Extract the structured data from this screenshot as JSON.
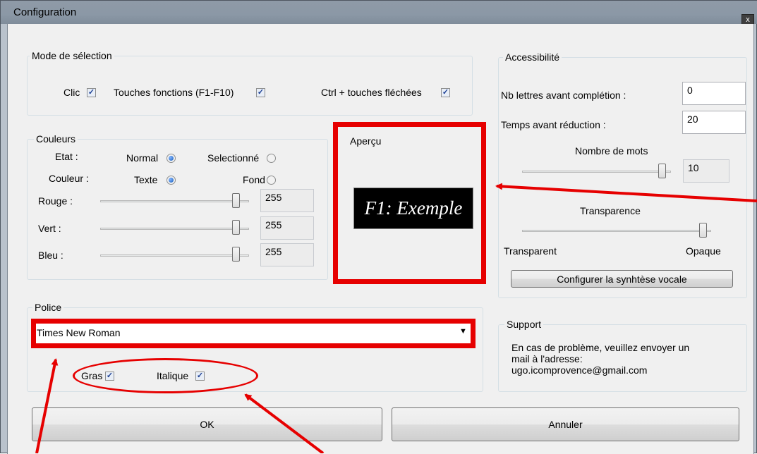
{
  "window": {
    "title": "Configuration",
    "close_glyph": "x"
  },
  "selection_mode": {
    "legend": "Mode de sélection",
    "click_label": "Clic",
    "fkeys_label": "Touches fonctions (F1-F10)",
    "ctrl_label": "Ctrl + touches fléchées"
  },
  "colors": {
    "legend": "Couleurs",
    "state_label": "Etat :",
    "normal_label": "Normal",
    "selected_label": "Selectionné",
    "color_label": "Couleur :",
    "text_label": "Texte",
    "background_label": "Fond",
    "red_label": "Rouge :",
    "green_label": "Vert :",
    "blue_label": "Bleu :",
    "red_value": "255",
    "green_value": "255",
    "blue_value": "255"
  },
  "preview": {
    "legend": "Aperçu",
    "sample_text": "F1: Exemple"
  },
  "accessibility": {
    "legend": "Accessibilité",
    "letters_label": "Nb lettres avant complétion :",
    "letters_value": "0",
    "delay_label": "Temps avant réduction :",
    "delay_value": "20",
    "words_label": "Nombre de mots",
    "words_value": "10",
    "transparency_label": "Transparence",
    "transparent_label": "Transparent",
    "opaque_label": "Opaque",
    "tts_button": "Configurer la synhtèse vocale"
  },
  "font": {
    "legend": "Police",
    "selected": "Times New Roman",
    "bold_label": "Gras",
    "italic_label": "Italique"
  },
  "support": {
    "legend": "Support",
    "line1": "En cas de problème, veuillez envoyer un",
    "line2": "mail à l'adresse:",
    "email": "ugo.icomprovence@gmail.com"
  },
  "buttons": {
    "ok": "OK",
    "cancel": "Annuler"
  },
  "annotation_color": "#e60000"
}
